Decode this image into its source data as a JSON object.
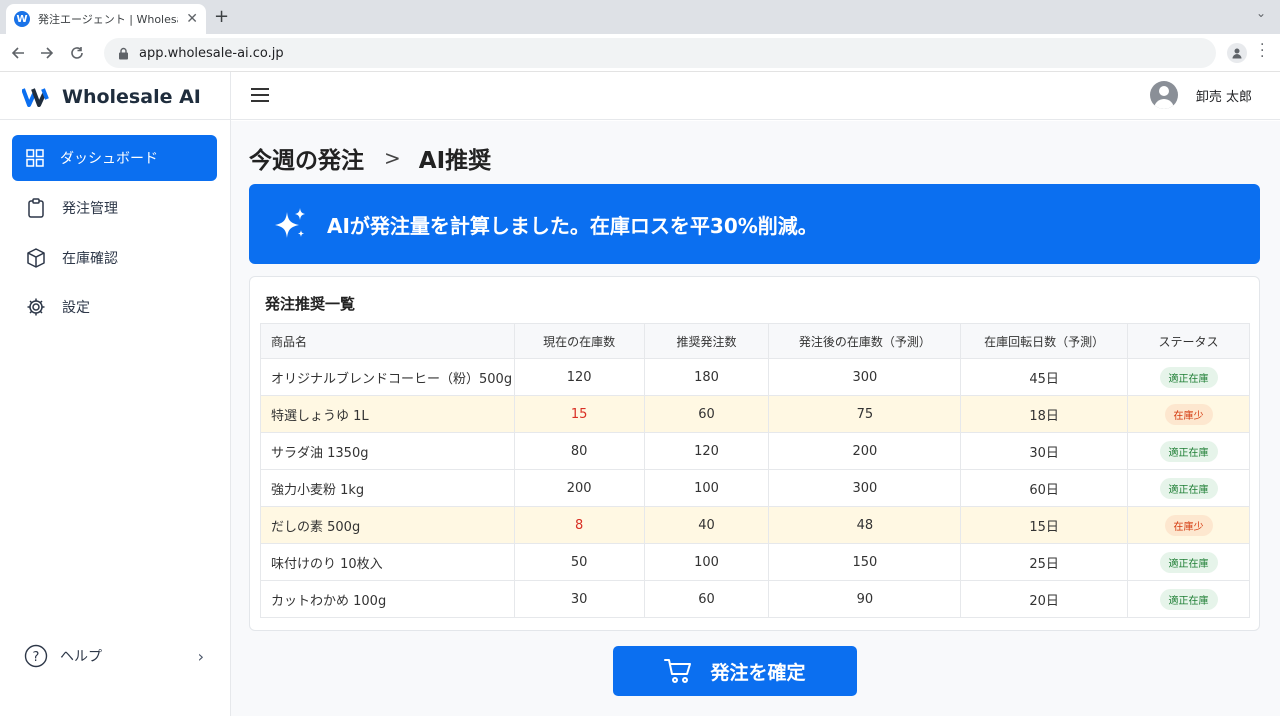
{
  "browser": {
    "tab_title": "発注エージェント | Wholesale AI",
    "favicon_letter": "W",
    "url": "app.wholesale-ai.co.jp"
  },
  "sidebar": {
    "brand": "Wholesale AI",
    "items": [
      {
        "label": "ダッシュボード",
        "icon": "grid-icon",
        "active": true
      },
      {
        "label": "発注管理",
        "icon": "clipboard-icon",
        "active": false
      },
      {
        "label": "在庫確認",
        "icon": "box-icon",
        "active": false
      },
      {
        "label": "設定",
        "icon": "gear-icon",
        "active": false
      }
    ],
    "help": {
      "label": "ヘルプ",
      "icon": "help-circle-icon"
    }
  },
  "header": {
    "user_name": "卸売 太郎"
  },
  "main": {
    "breadcrumb": [
      "今週の発注",
      "AI推奨"
    ],
    "breadcrumb_separator": ">",
    "banner_text": "AIが発注量を計算しました。在庫ロスを平30%削減。",
    "table_title": "発注推奨一覧",
    "columns": [
      "商品名",
      "現在の在庫数",
      "推奨発注数",
      "発注後の在庫数（予測）",
      "在庫回転日数（予測）",
      "ステータス"
    ],
    "rows": [
      {
        "name": "オリジナルブレンドコーヒー（粉）500g",
        "stock": "120",
        "recommended": "180",
        "after": "300",
        "days": "45日",
        "status": "適正在庫",
        "low": false
      },
      {
        "name": "特選しょうゆ 1L",
        "stock": "15",
        "recommended": "60",
        "after": "75",
        "days": "18日",
        "status": "在庫少",
        "low": true
      },
      {
        "name": "サラダ油 1350g",
        "stock": "80",
        "recommended": "120",
        "after": "200",
        "days": "30日",
        "status": "適正在庫",
        "low": false
      },
      {
        "name": "強力小麦粉 1kg",
        "stock": "200",
        "recommended": "100",
        "after": "300",
        "days": "60日",
        "status": "適正在庫",
        "low": false
      },
      {
        "name": "だしの素 500g",
        "stock": "8",
        "recommended": "40",
        "after": "48",
        "days": "15日",
        "status": "在庫少",
        "low": true
      },
      {
        "name": "味付けのり 10枚入",
        "stock": "50",
        "recommended": "100",
        "after": "150",
        "days": "25日",
        "status": "適正在庫",
        "low": false
      },
      {
        "name": "カットわかめ 100g",
        "stock": "30",
        "recommended": "60",
        "after": "90",
        "days": "20日",
        "status": "適正在庫",
        "low": false
      }
    ],
    "confirm_label": "発注を確定"
  },
  "colors": {
    "accent": "#0b6ff0",
    "low_row": "#fff8e3",
    "ok_badge": "#e6f4ea",
    "low_badge": "#fde7cf"
  }
}
